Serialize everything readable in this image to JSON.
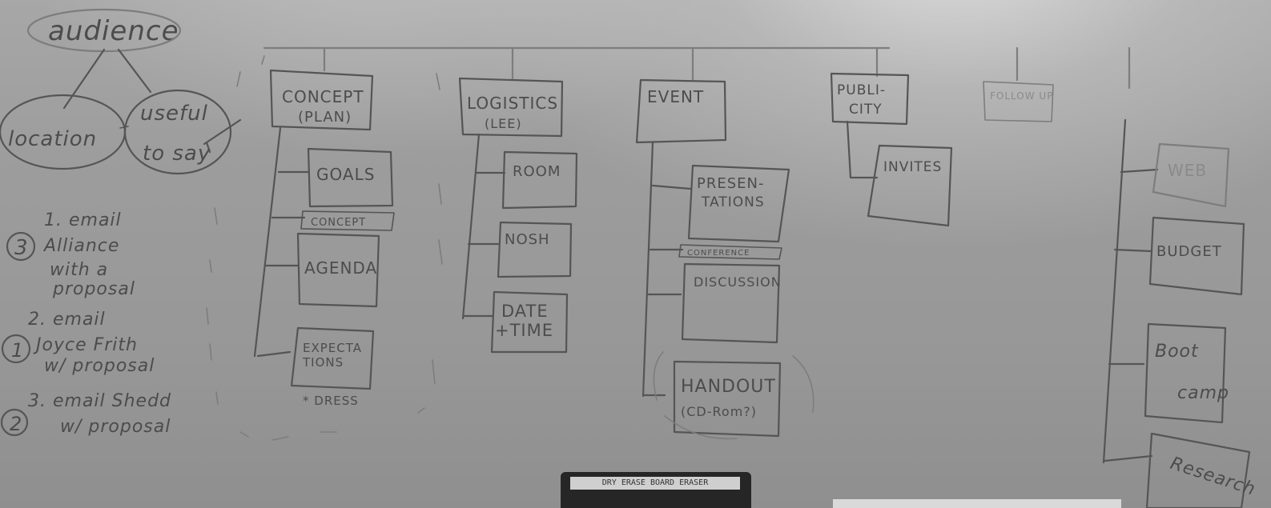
{
  "scene": {
    "description_kind": "whiteboard-photo",
    "colors": {
      "board": "#9a9a9a",
      "ink": "#4c4c4c",
      "eraser": "#262626"
    }
  },
  "left_notes": {
    "audience": "audience",
    "location": "location",
    "useful": "useful",
    "to_say": "to say",
    "item1_num": "3",
    "item1_text": [
      "1. email",
      "Alliance",
      "with a",
      "proposal"
    ],
    "item2_num": "1",
    "item2_text": [
      "2. email",
      "Joyce Frith",
      "w/ proposal"
    ],
    "item3_num": "2",
    "item3_text": [
      "3. email Shedd",
      "w/ proposal"
    ]
  },
  "columns": {
    "concept": {
      "header": [
        "CONCEPT",
        "(PLAN)"
      ],
      "items": [
        "GOALS",
        "CONCEPT",
        "AGENDA",
        "EXPECTA",
        "TIONS"
      ],
      "note": "* DRESS"
    },
    "logistics": {
      "header": [
        "LOGISTICS",
        "(LEE)"
      ],
      "items": [
        "ROOM",
        "NOSH",
        "DATE",
        "+TIME"
      ]
    },
    "event": {
      "header": "EVENT",
      "items": [
        "PRESEN-",
        "TATIONS",
        "CONFERENCE",
        "DISCUSSION",
        "HANDOUT",
        "(CD-Rom?)"
      ]
    },
    "publicity": {
      "header": [
        "PUBLI-",
        "CITY"
      ],
      "items": [
        "INVITES"
      ]
    },
    "followup": {
      "header": "FOLLOW UP"
    },
    "right": {
      "items": [
        "WEB",
        "BUDGET",
        "Boot",
        "camp",
        "Research"
      ]
    }
  },
  "eraser": {
    "label": "DRY ERASE BOARD ERASER"
  }
}
